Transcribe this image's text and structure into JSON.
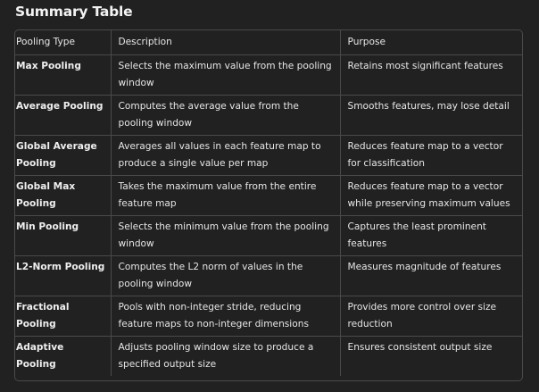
{
  "heading": "Summary Table",
  "table": {
    "headers": [
      "Pooling Type",
      "Description",
      "Purpose"
    ],
    "rows": [
      {
        "type": "Max Pooling",
        "description": "Selects the maximum value from the pooling window",
        "purpose": "Retains most significant features"
      },
      {
        "type": "Average Pooling",
        "description": "Computes the average value from the pooling window",
        "purpose": "Smooths features, may lose detail"
      },
      {
        "type": "Global Average Pooling",
        "description": "Averages all values in each feature map to produce a single value per map",
        "purpose": "Reduces feature map to a vector for classification"
      },
      {
        "type": "Global Max Pooling",
        "description": "Takes the maximum value from the entire feature map",
        "purpose": "Reduces feature map to a vector while preserving maximum values"
      },
      {
        "type": "Min Pooling",
        "description": "Selects the minimum value from the pooling window",
        "purpose": "Captures the least prominent features"
      },
      {
        "type": "L2-Norm Pooling",
        "description": "Computes the L2 norm of values in the pooling window",
        "purpose": "Measures magnitude of features"
      },
      {
        "type": "Fractional Pooling",
        "description": "Pools with non-integer stride, reducing feature maps to non-integer dimensions",
        "purpose": "Provides more control over size reduction"
      },
      {
        "type": "Adaptive Pooling",
        "description": "Adjusts pooling window size to produce a specified output size",
        "purpose": "Ensures consistent output size"
      }
    ]
  },
  "colors": {
    "background": "#212121",
    "border": "#4a4a4a",
    "text": "#e6e6e6"
  }
}
